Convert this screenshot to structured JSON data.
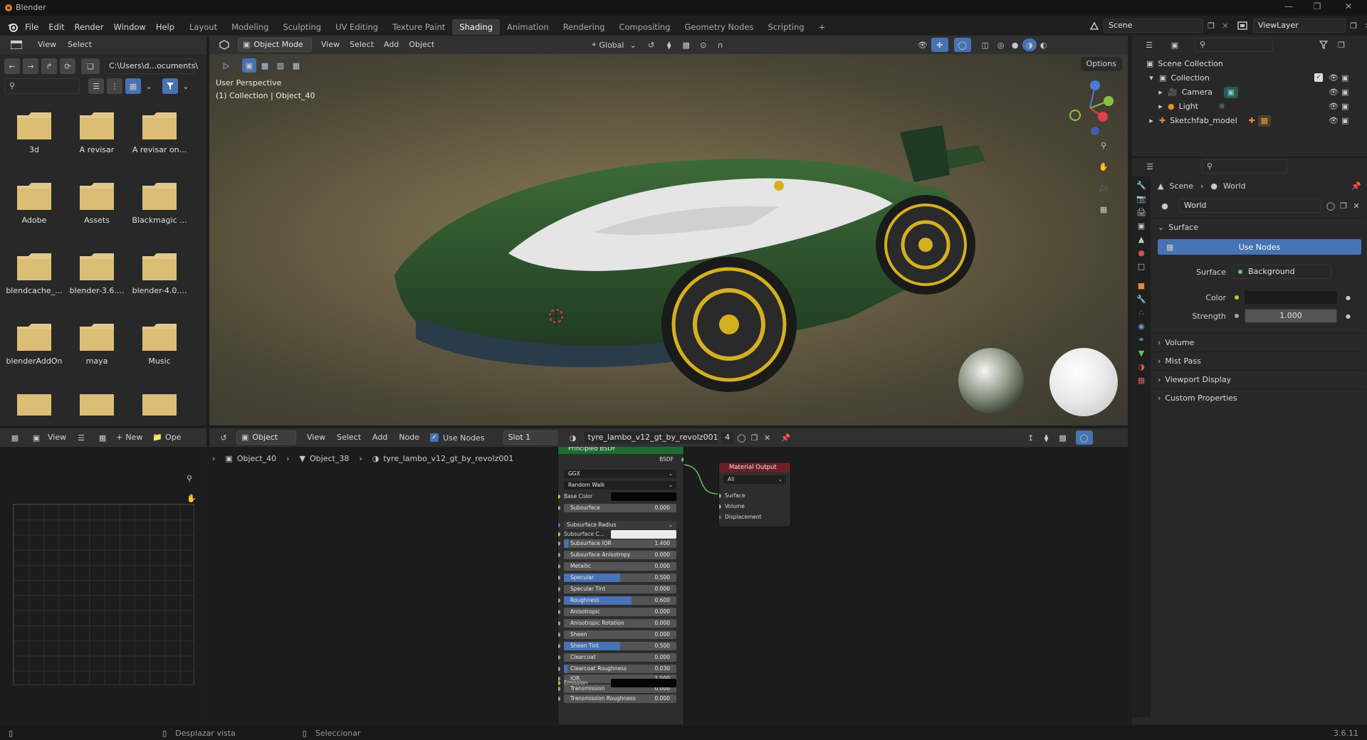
{
  "window": {
    "title": "Blender"
  },
  "menu": [
    "File",
    "Edit",
    "Render",
    "Window",
    "Help"
  ],
  "workspaces": [
    "Layout",
    "Modeling",
    "Sculpting",
    "UV Editing",
    "Texture Paint",
    "Shading",
    "Animation",
    "Rendering",
    "Compositing",
    "Geometry Nodes",
    "Scripting",
    "+"
  ],
  "scene": {
    "name": "Scene",
    "view_layer": "ViewLayer"
  },
  "file_browser": {
    "header": {
      "view": "View",
      "select": "Select"
    },
    "path": "C:\\Users\\d...ocuments\\",
    "folders": [
      "3d",
      "A revisar",
      "A revisar on...",
      "Adobe",
      "Assets",
      "Blackmagic ...",
      "blendcache_...",
      "blender-3.6....",
      "blender-4.0....",
      "blenderAddOn",
      "maya",
      "Music"
    ]
  },
  "viewport": {
    "mode": "Object Mode",
    "menus": [
      "View",
      "Select",
      "Add",
      "Object"
    ],
    "transform": "Global",
    "options": "Options",
    "perspective_label": "User Perspective",
    "collection_label": "(1) Collection | Object_40"
  },
  "outliner": {
    "items": [
      {
        "label": "Scene Collection"
      },
      {
        "label": "Collection"
      },
      {
        "label": "Camera"
      },
      {
        "label": "Light"
      },
      {
        "label": "Sketchfab_model"
      }
    ]
  },
  "properties": {
    "breadcrumb": {
      "scene": "Scene",
      "world": "World"
    },
    "world_name": "World",
    "surface_section": "Surface",
    "use_nodes": "Use Nodes",
    "surface_label": "Surface",
    "surface_value": "Background",
    "color_label": "Color",
    "strength_label": "Strength",
    "strength_value": "1.000",
    "sections": [
      "Volume",
      "Mist Pass",
      "Viewport Display",
      "Custom Properties"
    ]
  },
  "image_editor": {
    "view": "View",
    "new": "New",
    "open": "Ope"
  },
  "node_editor": {
    "object_type": "Object",
    "menus": [
      "View",
      "Select",
      "Add",
      "Node"
    ],
    "use_nodes": "Use Nodes",
    "slot": "Slot 1",
    "material": "tyre_lambo_v12_gt_by_revolz001",
    "users": "4",
    "breadcrumb": [
      "Object_40",
      "Object_38",
      "tyre_lambo_v12_gt_by_revolz001"
    ],
    "principled": {
      "title": "Principled BSDF",
      "output": "BSDF",
      "distribution": "GGX",
      "sss_method": "Random Walk",
      "base_color": "Base Color",
      "subsurface_radius": "Subsurface Radius",
      "subsurface_color": "Subsurface C...",
      "emission": "Emission",
      "params": [
        {
          "label": "Subsurface",
          "value": "0.000",
          "fill": 0
        },
        {
          "label": "Subsurface IOR",
          "value": "1.400",
          "fill": 0.04
        },
        {
          "label": "Subsurface Anisotropy",
          "value": "0.000",
          "fill": 0
        },
        {
          "label": "Metallic",
          "value": "0.000",
          "fill": 0
        },
        {
          "label": "Specular",
          "value": "0.500",
          "fill": 0.5
        },
        {
          "label": "Specular Tint",
          "value": "0.000",
          "fill": 0
        },
        {
          "label": "Roughness",
          "value": "0.600",
          "fill": 0.6
        },
        {
          "label": "Anisotropic",
          "value": "0.000",
          "fill": 0
        },
        {
          "label": "Anisotropic Rotation",
          "value": "0.000",
          "fill": 0
        },
        {
          "label": "Sheen",
          "value": "0.000",
          "fill": 0
        },
        {
          "label": "Sheen Tint",
          "value": "0.500",
          "fill": 0.5
        },
        {
          "label": "Clearcoat",
          "value": "0.000",
          "fill": 0
        },
        {
          "label": "Clearcoat Roughness",
          "value": "0.030",
          "fill": 0.03
        },
        {
          "label": "IOR",
          "value": "1.500",
          "fill": 0
        },
        {
          "label": "Transmission",
          "value": "0.000",
          "fill": 0
        },
        {
          "label": "Transmission Roughness",
          "value": "0.000",
          "fill": 0
        }
      ]
    },
    "output_node": {
      "title": "Material Output",
      "target": "All",
      "inputs": [
        "Surface",
        "Volume",
        "Displacement"
      ]
    }
  },
  "status_bar": {
    "pan_view": "Desplazar vista",
    "select": "Seleccionar",
    "version": "3.6.11"
  },
  "colors": {
    "accent": "#4772b3",
    "header_bg": "#303030",
    "node_header_green": "#1e6b32",
    "node_header_red": "#6a2026",
    "socket_yellow": "#c7c729",
    "socket_green": "#63c763",
    "socket_purple": "#6363c7",
    "socket_gray": "#a1a1a1"
  }
}
